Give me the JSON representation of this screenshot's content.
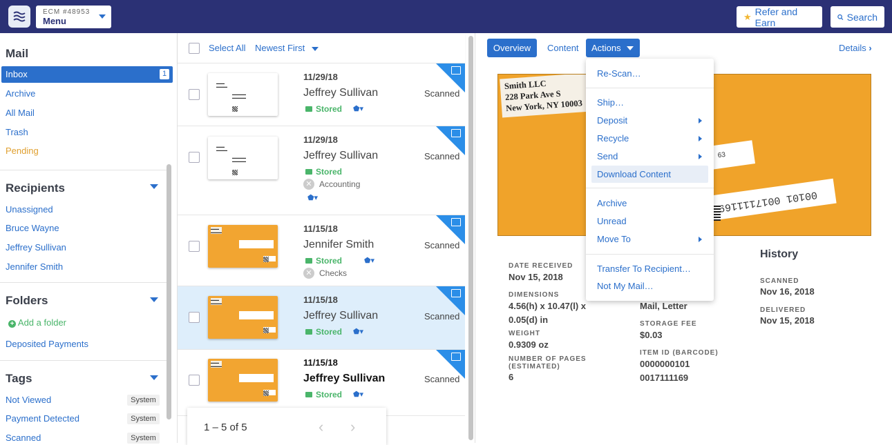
{
  "topbar": {
    "account_code": "ECM #48953",
    "menu_label": "Menu",
    "refer_label": "Refer and Earn",
    "search_label": "Search"
  },
  "sidebar": {
    "mail_title": "Mail",
    "mail_items": [
      {
        "label": "Inbox",
        "count": "1"
      },
      {
        "label": "Archive"
      },
      {
        "label": "All Mail"
      },
      {
        "label": "Trash"
      },
      {
        "label": "Pending"
      }
    ],
    "recipients_title": "Recipients",
    "recipients": [
      "Unassigned",
      "Bruce Wayne",
      "Jeffrey Sullivan",
      "Jennifer Smith"
    ],
    "folders_title": "Folders",
    "add_folder": "Add a folder",
    "folders": [
      "Deposited Payments"
    ],
    "tags_title": "Tags",
    "tags": [
      {
        "label": "Not Viewed",
        "badge": "System"
      },
      {
        "label": "Payment Detected",
        "badge": "System"
      },
      {
        "label": "Scanned",
        "badge": "System"
      }
    ]
  },
  "list": {
    "select_all": "Select All",
    "sort": "Newest First",
    "rows": [
      {
        "date": "11/29/18",
        "name": "Jeffrey Sullivan",
        "status": "Scanned",
        "stored": "Stored",
        "category": ""
      },
      {
        "date": "11/29/18",
        "name": "Jeffrey Sullivan",
        "status": "Scanned",
        "stored": "Stored",
        "category": "Accounting"
      },
      {
        "date": "11/15/18",
        "name": "Jennifer Smith",
        "status": "Scanned",
        "stored": "Stored",
        "category": "Checks"
      },
      {
        "date": "11/15/18",
        "name": "Jeffrey Sullivan",
        "status": "Scanned",
        "stored": "Stored",
        "category": ""
      },
      {
        "date": "11/15/18",
        "name": "Jeffrey Sullivan",
        "status": "Scanned",
        "stored": "Stored",
        "category": ""
      }
    ],
    "pager": "1 – 5 of 5"
  },
  "detail": {
    "tabs": {
      "overview": "Overview",
      "content": "Content",
      "actions": "Actions"
    },
    "details_link": "Details",
    "envelope": {
      "return_address": [
        "Smith LLC",
        "228 Park Ave S",
        "New York, NY 10003"
      ],
      "label_partial": "63",
      "barcode_text": "00101 0017111169"
    },
    "fields": {
      "date_received_label": "DATE RECEIVED",
      "date_received": "Nov 15, 2018",
      "dimensions_label": "DIMENSIONS",
      "dimensions_1": "4.56(h) x 10.47(l) x",
      "dimensions_2": "0.05(d) in",
      "weight_label": "WEIGHT",
      "weight": "0.9309 oz",
      "pages_label_1": "NUMBER OF PAGES",
      "pages_label_2": "(ESTIMATED)",
      "pages": "6",
      "type": "Mail, Letter",
      "storage_fee_label": "STORAGE FEE",
      "storage_fee": "$0.03",
      "item_id_label": "ITEM ID (BARCODE)",
      "item_id_1": "0000000101",
      "item_id_2": "0017111169"
    },
    "history": {
      "title": "History",
      "scanned_label": "SCANNED",
      "scanned": "Nov 16, 2018",
      "delivered_label": "DELIVERED",
      "delivered": "Nov 15, 2018"
    }
  },
  "actions_menu": {
    "rescan": "Re-Scan…",
    "ship": "Ship…",
    "deposit": "Deposit",
    "recycle": "Recycle",
    "send": "Send",
    "download": "Download Content",
    "archive": "Archive",
    "unread": "Unread",
    "move_to": "Move To",
    "transfer": "Transfer To Recipient…",
    "not_my_mail": "Not My Mail…"
  },
  "colors": {
    "nav": "#2b3175",
    "accent": "#2b6fcb",
    "stored": "#4ab56a",
    "pending": "#e0a030",
    "envelope": "#f0a32a"
  }
}
